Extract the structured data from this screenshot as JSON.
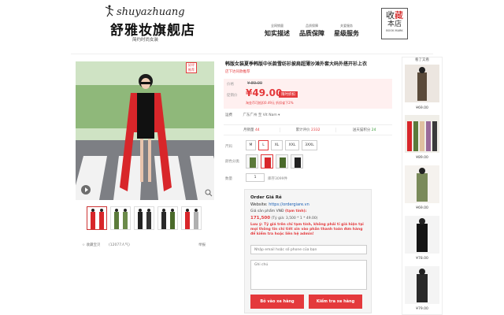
{
  "header": {
    "logo_script": "shuyazhuang",
    "logo_main": "舒雅妆旗舰店",
    "logo_sub": "简约时尚女装",
    "items": [
      {
        "small": "全网销量",
        "big": "知实描述"
      },
      {
        "small": "品质保障",
        "big": "品质保障"
      },
      {
        "small": "关爱服务",
        "big": "星级服务"
      }
    ],
    "bookmark": {
      "line1a": "收",
      "line1b": "藏",
      "line2": "本店",
      "line3": "BOOK MARK"
    }
  },
  "gallery": {
    "badge": "好评\n推荐",
    "note_left": "收藏宝贝",
    "note_mid": "(12077人气)",
    "note_right": "举报"
  },
  "product": {
    "title": "韩版女装夏季韩版中长款雪纺衫披肩超薄沙滩外套大码外搭开衫上衣",
    "subtitle": "店下达同款推荐",
    "price_label": "价格",
    "old_price": "¥ 89.00",
    "promo_label": "促销价",
    "new_price": "¥49.00",
    "promo_badge": "限时折扣",
    "promo_note": "淘金币可抵扣0.49元 折扣省下2%",
    "ship_label": "运费",
    "ship_text": "广东广州 至 Vit Nam ▾",
    "stats": [
      {
        "label": "月销量",
        "value": "44"
      },
      {
        "label": "累计评价",
        "value": "2332"
      },
      {
        "label": "送天猫积分",
        "value": "24"
      }
    ],
    "size_label": "尺码",
    "sizes": [
      "M",
      "L",
      "XL",
      "XXL",
      "3XXL"
    ],
    "selected_size": "L",
    "color_label": "颜色分类",
    "qty_label": "数量",
    "qty_value": "1",
    "stock_text": "库存3099件"
  },
  "order": {
    "title": "Order Giá Rẻ",
    "website_label": "Website: ",
    "website_url": "https://ordergiare.vn",
    "vnd_label": "Giá sản phẩm VNĐ ",
    "vnd_hint": "(tạm tính):",
    "price_vnd": "171,500",
    "price_formula": " (Tỷ giá: 3,500 * 1 * 49.00)",
    "warning": "Lưu ý: Tỷ giá trên chỉ tạm tính, không phải tỉ giá hiện tại mọi thông tin chi tiết xin vào phần thanh toán đơn hàng để kiểm tra hoặc liên hệ admin!",
    "email_placeholder": "Nhập email hoặc số phone của bạn",
    "note_placeholder": "Ghi chú",
    "btn_cart": "Bỏ vào xe hàng",
    "btn_check": "Kiểm tra xe hàng"
  },
  "sidebar": {
    "title": "看了又看",
    "items": [
      {
        "price": "¥69.00"
      },
      {
        "price": "¥89.00"
      },
      {
        "price": "¥69.00"
      },
      {
        "price": "¥78.00"
      },
      {
        "price": "¥79.00"
      }
    ]
  },
  "colors": {
    "accent": "#e4393c",
    "link": "#1a5fb4"
  }
}
